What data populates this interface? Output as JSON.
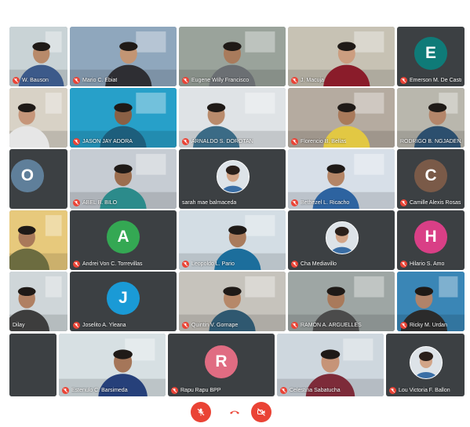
{
  "colors": {
    "tile_bg": "#3c4043",
    "mute_red": "#ea4335",
    "control_red": "#ea4335"
  },
  "participants": [
    {
      "name": "W. Bauson",
      "type": "video",
      "muted": true
    },
    {
      "name": "Mario C. Ebiat",
      "type": "video",
      "muted": true
    },
    {
      "name": "Eugene Willy Francisco",
      "type": "video",
      "muted": true
    },
    {
      "name": "J. Macuja",
      "type": "video",
      "muted": true
    },
    {
      "name": "Emerson M. De Castro",
      "type": "avatar",
      "initial": "E",
      "color": "#0f7b78",
      "muted": true
    },
    {
      "name": "",
      "type": "video",
      "muted": false
    },
    {
      "name": "JASON JAY ADORA",
      "type": "video",
      "muted": true
    },
    {
      "name": "ARNALDO S. DOROTAN",
      "type": "video",
      "muted": true
    },
    {
      "name": "Florencio B. Bellas",
      "type": "video",
      "muted": true
    },
    {
      "name": "RODRIGO B. NGJADENA",
      "type": "video",
      "muted": false
    },
    {
      "name": "",
      "type": "avatar",
      "initial": "O",
      "color": "#5f7f9a",
      "muted": false
    },
    {
      "name": "ABEL B. BILO",
      "type": "video",
      "muted": true
    },
    {
      "name": "sarah mae balmaceda",
      "type": "photo",
      "muted": false
    },
    {
      "name": "Bethezel L. Ricacho",
      "type": "video",
      "muted": true
    },
    {
      "name": "Camille Alexis Rosas",
      "type": "avatar",
      "initial": "C",
      "color": "#7a5a48",
      "muted": true
    },
    {
      "name": "",
      "type": "video",
      "muted": false
    },
    {
      "name": "Andrei Von C. Torrevillas",
      "type": "avatar",
      "initial": "A",
      "color": "#34a853",
      "muted": true
    },
    {
      "name": "Leopoldo L. Pario",
      "type": "video",
      "muted": true
    },
    {
      "name": "Cha Mediavillo",
      "type": "photo",
      "muted": true
    },
    {
      "name": "Hilario S. Amo",
      "type": "avatar",
      "initial": "H",
      "color": "#d93f86",
      "muted": true
    },
    {
      "name": "Dilay",
      "type": "video",
      "muted": false
    },
    {
      "name": "Joselito A. Yleana",
      "type": "avatar",
      "initial": "J",
      "color": "#1a9ad6",
      "muted": true
    },
    {
      "name": "Quintin V. Gornape",
      "type": "video",
      "muted": true
    },
    {
      "name": "RAMON A. ARGUELLES",
      "type": "video",
      "muted": true
    },
    {
      "name": "Ricky M. Urdan",
      "type": "video",
      "muted": true
    },
    {
      "name": "",
      "type": "video",
      "muted": false
    },
    {
      "name": "Estenulo C. Barsimeda",
      "type": "video",
      "muted": true
    },
    {
      "name": "Rapu Rapu BPP",
      "type": "avatar",
      "initial": "R",
      "color": "#e06c82",
      "muted": true
    },
    {
      "name": "Celestina Sabatucha",
      "type": "video",
      "muted": true
    },
    {
      "name": "Lou Victoria F. Ballon",
      "type": "photo",
      "muted": true
    }
  ],
  "controls": {
    "mic_label": "Turn on microphone",
    "leave_label": "Leave call",
    "camera_label": "Turn on camera"
  }
}
